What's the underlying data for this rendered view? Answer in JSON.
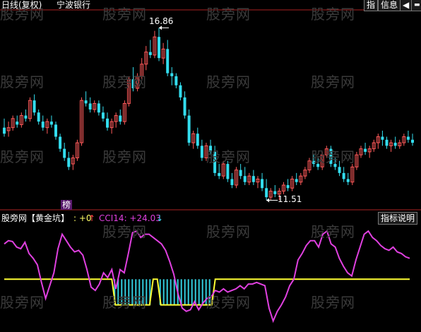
{
  "header": {
    "period_label": "日线(复权)",
    "stock_name": "宁波银行",
    "btn_index": "指",
    "btn_info": "信息",
    "btn_back": "◀",
    "btn_min": "▬"
  },
  "watermark": "股旁网",
  "main_chart": {
    "high_label": "16.86",
    "low_label": "11.51",
    "rank_badge": "榜",
    "ylim": [
      11.0,
      17.4
    ],
    "colors": {
      "up": "#ff5a5a",
      "down": "#33ddee",
      "annotation": "#ffffff"
    }
  },
  "indicator": {
    "source_label": "股旁网",
    "name_label": "【黄金坑】",
    "value_label": ": +0",
    "up_arrow": "↑",
    "cci_label": "CCI14: +24.03",
    "down_arrow": "↓",
    "help_button": "指标说明",
    "colors": {
      "cci": "#e040e0",
      "threshold": "#ffff33",
      "bars": "#33ccdd",
      "value": "#ffff66",
      "arrow_up": "#ff4444",
      "arrow_down": "#33ddee"
    }
  },
  "chart_data": [
    {
      "type": "candlestick",
      "title": "宁波银行 日线(复权)",
      "annotations": [
        {
          "label": "16.86",
          "kind": "high"
        },
        {
          "label": "11.51",
          "kind": "low"
        }
      ],
      "candles": [
        [
          13.6,
          13.9,
          13.3,
          13.4
        ],
        [
          13.5,
          13.8,
          13.3,
          13.6
        ],
        [
          13.6,
          14.0,
          13.5,
          13.9
        ],
        [
          13.8,
          14.0,
          13.6,
          13.7
        ],
        [
          13.7,
          14.1,
          13.6,
          14.0
        ],
        [
          14.0,
          14.2,
          13.8,
          13.9
        ],
        [
          13.9,
          14.6,
          13.8,
          14.5
        ],
        [
          14.5,
          14.7,
          14.0,
          14.1
        ],
        [
          14.1,
          14.2,
          13.7,
          13.8
        ],
        [
          13.8,
          14.0,
          13.5,
          13.6
        ],
        [
          13.6,
          13.9,
          13.4,
          13.8
        ],
        [
          13.8,
          14.0,
          13.6,
          13.7
        ],
        [
          13.7,
          13.8,
          13.2,
          13.3
        ],
        [
          13.3,
          13.4,
          12.8,
          12.9
        ],
        [
          12.9,
          13.1,
          12.5,
          12.6
        ],
        [
          12.6,
          12.8,
          12.2,
          12.3
        ],
        [
          12.4,
          12.7,
          12.2,
          12.6
        ],
        [
          12.6,
          13.2,
          12.5,
          13.1
        ],
        [
          13.1,
          14.6,
          13.0,
          14.5
        ],
        [
          14.5,
          14.8,
          14.3,
          14.4
        ],
        [
          14.4,
          14.6,
          14.1,
          14.2
        ],
        [
          14.2,
          14.5,
          14.1,
          14.4
        ],
        [
          14.4,
          14.5,
          14.0,
          14.1
        ],
        [
          14.1,
          14.3,
          13.8,
          13.9
        ],
        [
          13.9,
          14.1,
          13.5,
          13.6
        ],
        [
          13.6,
          13.9,
          13.4,
          13.8
        ],
        [
          13.8,
          14.1,
          13.6,
          14.0
        ],
        [
          14.0,
          14.2,
          13.7,
          13.8
        ],
        [
          13.8,
          14.5,
          13.7,
          14.4
        ],
        [
          14.4,
          15.3,
          14.3,
          15.2
        ],
        [
          15.2,
          15.6,
          14.8,
          14.9
        ],
        [
          14.9,
          15.4,
          14.8,
          15.3
        ],
        [
          15.3,
          15.9,
          15.2,
          15.7
        ],
        [
          15.7,
          16.3,
          15.5,
          16.1
        ],
        [
          16.1,
          16.5,
          15.9,
          16.0
        ],
        [
          16.0,
          16.8,
          15.9,
          16.6
        ],
        [
          16.6,
          16.9,
          15.8,
          15.9
        ],
        [
          15.9,
          16.4,
          15.7,
          16.2
        ],
        [
          16.2,
          16.5,
          15.3,
          15.4
        ],
        [
          15.4,
          15.6,
          15.0,
          15.3
        ],
        [
          15.3,
          15.4,
          14.9,
          15.0
        ],
        [
          15.0,
          15.1,
          14.5,
          14.6
        ],
        [
          14.6,
          14.8,
          13.9,
          14.0
        ],
        [
          14.0,
          14.2,
          13.0,
          13.1
        ],
        [
          13.1,
          13.5,
          12.9,
          13.4
        ],
        [
          13.4,
          13.6,
          12.9,
          13.0
        ],
        [
          13.0,
          13.2,
          12.5,
          12.6
        ],
        [
          12.6,
          13.1,
          12.5,
          13.0
        ],
        [
          13.0,
          13.2,
          12.7,
          12.8
        ],
        [
          12.8,
          13.0,
          12.0,
          12.1
        ],
        [
          12.1,
          12.4,
          11.9,
          12.0
        ],
        [
          12.0,
          12.5,
          11.9,
          12.4
        ],
        [
          12.4,
          12.5,
          11.8,
          11.9
        ],
        [
          11.9,
          12.1,
          11.6,
          11.7
        ],
        [
          11.7,
          12.3,
          11.6,
          12.2
        ],
        [
          12.2,
          12.4,
          11.9,
          12.0
        ],
        [
          12.0,
          12.3,
          11.7,
          11.8
        ],
        [
          11.8,
          12.1,
          11.7,
          12.0
        ],
        [
          12.0,
          12.2,
          11.7,
          11.8
        ],
        [
          11.8,
          12.0,
          11.6,
          11.9
        ],
        [
          11.9,
          12.1,
          11.5,
          11.6
        ],
        [
          11.6,
          11.9,
          11.2,
          11.3
        ],
        [
          11.3,
          11.6,
          11.2,
          11.5
        ],
        [
          11.5,
          11.7,
          11.3,
          11.4
        ],
        [
          11.4,
          11.6,
          11.2,
          11.5
        ],
        [
          11.5,
          11.8,
          11.4,
          11.7
        ],
        [
          11.7,
          11.9,
          11.5,
          11.6
        ],
        [
          11.6,
          12.0,
          11.5,
          11.9
        ],
        [
          11.9,
          12.1,
          11.7,
          11.8
        ],
        [
          11.8,
          12.1,
          11.7,
          12.0
        ],
        [
          12.0,
          12.3,
          11.9,
          12.2
        ],
        [
          12.2,
          12.6,
          12.1,
          12.5
        ],
        [
          12.5,
          12.7,
          12.3,
          12.4
        ],
        [
          12.4,
          12.6,
          12.2,
          12.3
        ],
        [
          12.3,
          12.8,
          12.2,
          12.7
        ],
        [
          12.7,
          13.0,
          12.6,
          12.9
        ],
        [
          12.9,
          13.0,
          12.3,
          12.4
        ],
        [
          12.4,
          12.6,
          12.2,
          12.3
        ],
        [
          12.3,
          12.5,
          12.0,
          12.1
        ],
        [
          12.1,
          12.3,
          11.8,
          11.9
        ],
        [
          11.9,
          12.1,
          11.7,
          11.8
        ],
        [
          11.8,
          12.4,
          11.7,
          12.3
        ],
        [
          12.3,
          12.8,
          12.2,
          12.7
        ],
        [
          12.7,
          13.0,
          12.6,
          12.9
        ],
        [
          12.9,
          13.1,
          12.7,
          12.8
        ],
        [
          12.8,
          13.0,
          12.6,
          12.9
        ],
        [
          12.9,
          13.2,
          12.8,
          13.1
        ],
        [
          13.1,
          13.4,
          12.9,
          13.3
        ],
        [
          13.3,
          13.5,
          13.0,
          13.2
        ],
        [
          13.2,
          13.3,
          12.9,
          13.0
        ],
        [
          13.0,
          13.2,
          12.8,
          13.1
        ],
        [
          13.1,
          13.3,
          12.9,
          13.0
        ],
        [
          13.0,
          13.2,
          12.9,
          13.1
        ],
        [
          13.1,
          13.4,
          13.0,
          13.3
        ],
        [
          13.3,
          13.5,
          13.1,
          13.2
        ],
        [
          13.2,
          13.4,
          13.0,
          13.1
        ]
      ]
    },
    {
      "type": "line",
      "title": "黄金坑 CCI14",
      "series": [
        {
          "name": "CCI14",
          "values": [
            220,
            240,
            235,
            200,
            190,
            230,
            160,
            130,
            90,
            -20,
            -120,
            -40,
            40,
            190,
            280,
            240,
            200,
            170,
            180,
            150,
            60,
            -50,
            -70,
            -30,
            40,
            10,
            60,
            -60,
            60,
            40,
            160,
            290,
            300,
            260,
            280,
            280,
            260,
            240,
            220,
            180,
            110,
            30,
            -90,
            -180,
            -200,
            -190,
            -140,
            -190,
            -150,
            -120,
            -110,
            -70,
            -80,
            -60,
            -80,
            -70,
            -60,
            -40,
            -60,
            -30,
            -30,
            -20,
            -30,
            -40,
            -180,
            -260,
            -200,
            -160,
            -110,
            -40,
            0,
            120,
            160,
            210,
            240,
            240,
            200,
            280,
            300,
            220,
            200,
            130,
            80,
            40,
            20,
            120,
            200,
            280,
            300,
            260,
            240,
            210,
            190,
            180,
            200,
            170,
            160,
            140,
            130
          ]
        },
        {
          "name": "",
          "values": [
            0
          ]
        }
      ],
      "trigger_segments": [
        [
          26,
          36
        ],
        [
          37,
          51
        ]
      ],
      "ylim": [
        -320,
        340
      ]
    }
  ]
}
